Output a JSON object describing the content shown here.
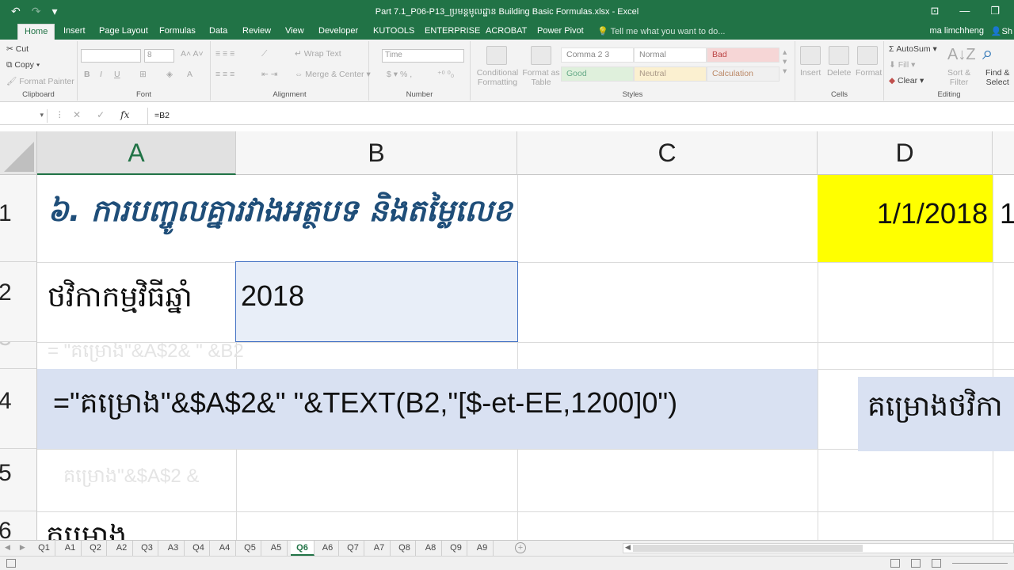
{
  "window": {
    "title": "Part 7.1_P06-P13_ប្រមន្តមូលដ្ឋាន Building Basic Formulas.xlsx - Excel",
    "qat_undo": "↶",
    "qat_redo": "↷",
    "qat_custom": "▾"
  },
  "ribbon_tabs": [
    "Home",
    "Insert",
    "Page Layout",
    "Formulas",
    "Data",
    "Review",
    "View",
    "Developer",
    "KUTOOLS",
    "ENTERPRISE",
    "ACROBAT",
    "Power Pivot"
  ],
  "tell_me": "Tell me what you want to do...",
  "user_name": "ma limchheng",
  "share_label": "Sh",
  "ribbon": {
    "clipboard": {
      "cut": "Cut",
      "copy": "Copy",
      "format_painter": "Format Painter",
      "name": "Clipboard"
    },
    "font": {
      "font_size": "8",
      "name": "Font"
    },
    "alignment": {
      "wrap_text": "Wrap Text",
      "merge_center": "Merge & Center",
      "name": "Alignment"
    },
    "number": {
      "format": "Time",
      "name": "Number"
    },
    "styles": {
      "conditional_formatting_1": "Conditional",
      "conditional_formatting_2": "Formatting",
      "format_as_table_1": "Format as",
      "format_as_table_2": "Table",
      "cells": [
        "Comma 2 3",
        "Normal",
        "Bad",
        "Good",
        "Neutral",
        "Calculation"
      ],
      "name": "Styles"
    },
    "cells": {
      "insert": "Insert",
      "delete": "Delete",
      "format": "Format",
      "name": "Cells"
    },
    "editing": {
      "autosum": "AutoSum",
      "fill": "Fill",
      "clear": "Clear",
      "sort_filter_1": "Sort &",
      "sort_filter_2": "Filter",
      "find_select_1": "Find &",
      "find_select_2": "Select",
      "name": "Editing"
    }
  },
  "formula_bar": {
    "name_box": "",
    "formula": "=B2"
  },
  "columns": [
    "A",
    "B",
    "C",
    "D"
  ],
  "rows": [
    "1",
    "2",
    "3",
    "4",
    "5",
    "6"
  ],
  "cells": {
    "A1": "៦. ការបញ្ចូលគ្នារវាងអត្ថបទ និងតម្លៃលេខ",
    "D1": "1/1/2018",
    "E1_partial": "1",
    "A2": "ថវិកាកម្មវិធីឆ្នាំ",
    "B2": "2018",
    "A3_ghost": "= \"គម្រោង\"&A$2& \" &B2",
    "A4": "=\"គម្រោង\"&$A$2&\" \"&TEXT(B2,\"[$-et-EE,1200]0\")",
    "D4": "គម្រោងថវិកា",
    "A5_ghost": "គម្រោង\"&$A$2 &",
    "A6": "គម្រោង"
  },
  "sheets": [
    "Q1",
    "A1",
    "Q2",
    "A2",
    "Q3",
    "A3",
    "Q4",
    "A4",
    "Q5",
    "A5",
    "Q6",
    "A6",
    "Q7",
    "A7",
    "Q8",
    "A8",
    "Q9",
    "A9"
  ],
  "active_sheet": "Q6",
  "colors": {
    "excel_green": "#217346",
    "title_blue": "#1f4e79",
    "highlight_yellow": "#ffff00",
    "row4_fill": "#d9e1f2"
  }
}
